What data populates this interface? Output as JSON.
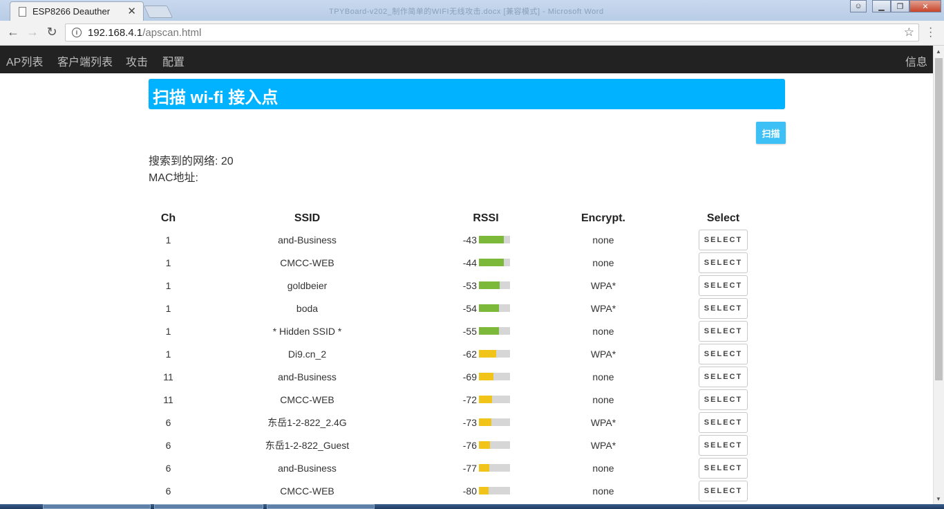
{
  "browser": {
    "tab_title": "ESP8266 Deauther",
    "url_host": "192.168.4.1",
    "url_path": "/apscan.html",
    "window_title_faded": "TPYBoard-v202_制作简单的WIFI无线攻击.docx [兼容模式] - Microsoft Word"
  },
  "nav": {
    "items": [
      "AP列表",
      "客户端列表",
      "攻击",
      "配置"
    ],
    "info": "信息"
  },
  "page": {
    "title": "扫描 wi-fi 接入点",
    "scan_button": "扫描",
    "networks_label": "搜索到的网络: 20",
    "mac_label": "MAC地址:"
  },
  "table": {
    "headers": [
      "Ch",
      "SSID",
      "RSSI",
      "Encrypt.",
      "Select"
    ],
    "select_label": "SELECT",
    "rows": [
      {
        "ch": "1",
        "ssid": "and-Business",
        "rssi": "-43",
        "signal": 0.8,
        "enc": "none"
      },
      {
        "ch": "1",
        "ssid": "CMCC-WEB",
        "rssi": "-44",
        "signal": 0.8,
        "enc": "none"
      },
      {
        "ch": "1",
        "ssid": "goldbeier",
        "rssi": "-53",
        "signal": 0.67,
        "enc": "WPA*"
      },
      {
        "ch": "1",
        "ssid": "boda",
        "rssi": "-54",
        "signal": 0.65,
        "enc": "WPA*"
      },
      {
        "ch": "1",
        "ssid": "* Hidden SSID *",
        "rssi": "-55",
        "signal": 0.64,
        "enc": "none"
      },
      {
        "ch": "1",
        "ssid": "Di9.cn_2",
        "rssi": "-62",
        "signal": 0.55,
        "enc": "WPA*"
      },
      {
        "ch": "11",
        "ssid": "and-Business",
        "rssi": "-69",
        "signal": 0.46,
        "enc": "none"
      },
      {
        "ch": "11",
        "ssid": "CMCC-WEB",
        "rssi": "-72",
        "signal": 0.42,
        "enc": "none"
      },
      {
        "ch": "6",
        "ssid": "东岳1-2-822_2.4G",
        "rssi": "-73",
        "signal": 0.41,
        "enc": "WPA*"
      },
      {
        "ch": "6",
        "ssid": "东岳1-2-822_Guest",
        "rssi": "-76",
        "signal": 0.36,
        "enc": "WPA*"
      },
      {
        "ch": "6",
        "ssid": "and-Business",
        "rssi": "-77",
        "signal": 0.33,
        "enc": "none"
      },
      {
        "ch": "6",
        "ssid": "CMCC-WEB",
        "rssi": "-80",
        "signal": 0.3,
        "enc": "none"
      }
    ]
  },
  "colors": {
    "nav_bg": "#222222",
    "header_bg": "#00b2ff",
    "scan_button_bg": "#3cc0f5",
    "signal_strong": "#7cb83a",
    "signal_weak": "#f0c419",
    "meter_track": "#d6d6d6"
  }
}
